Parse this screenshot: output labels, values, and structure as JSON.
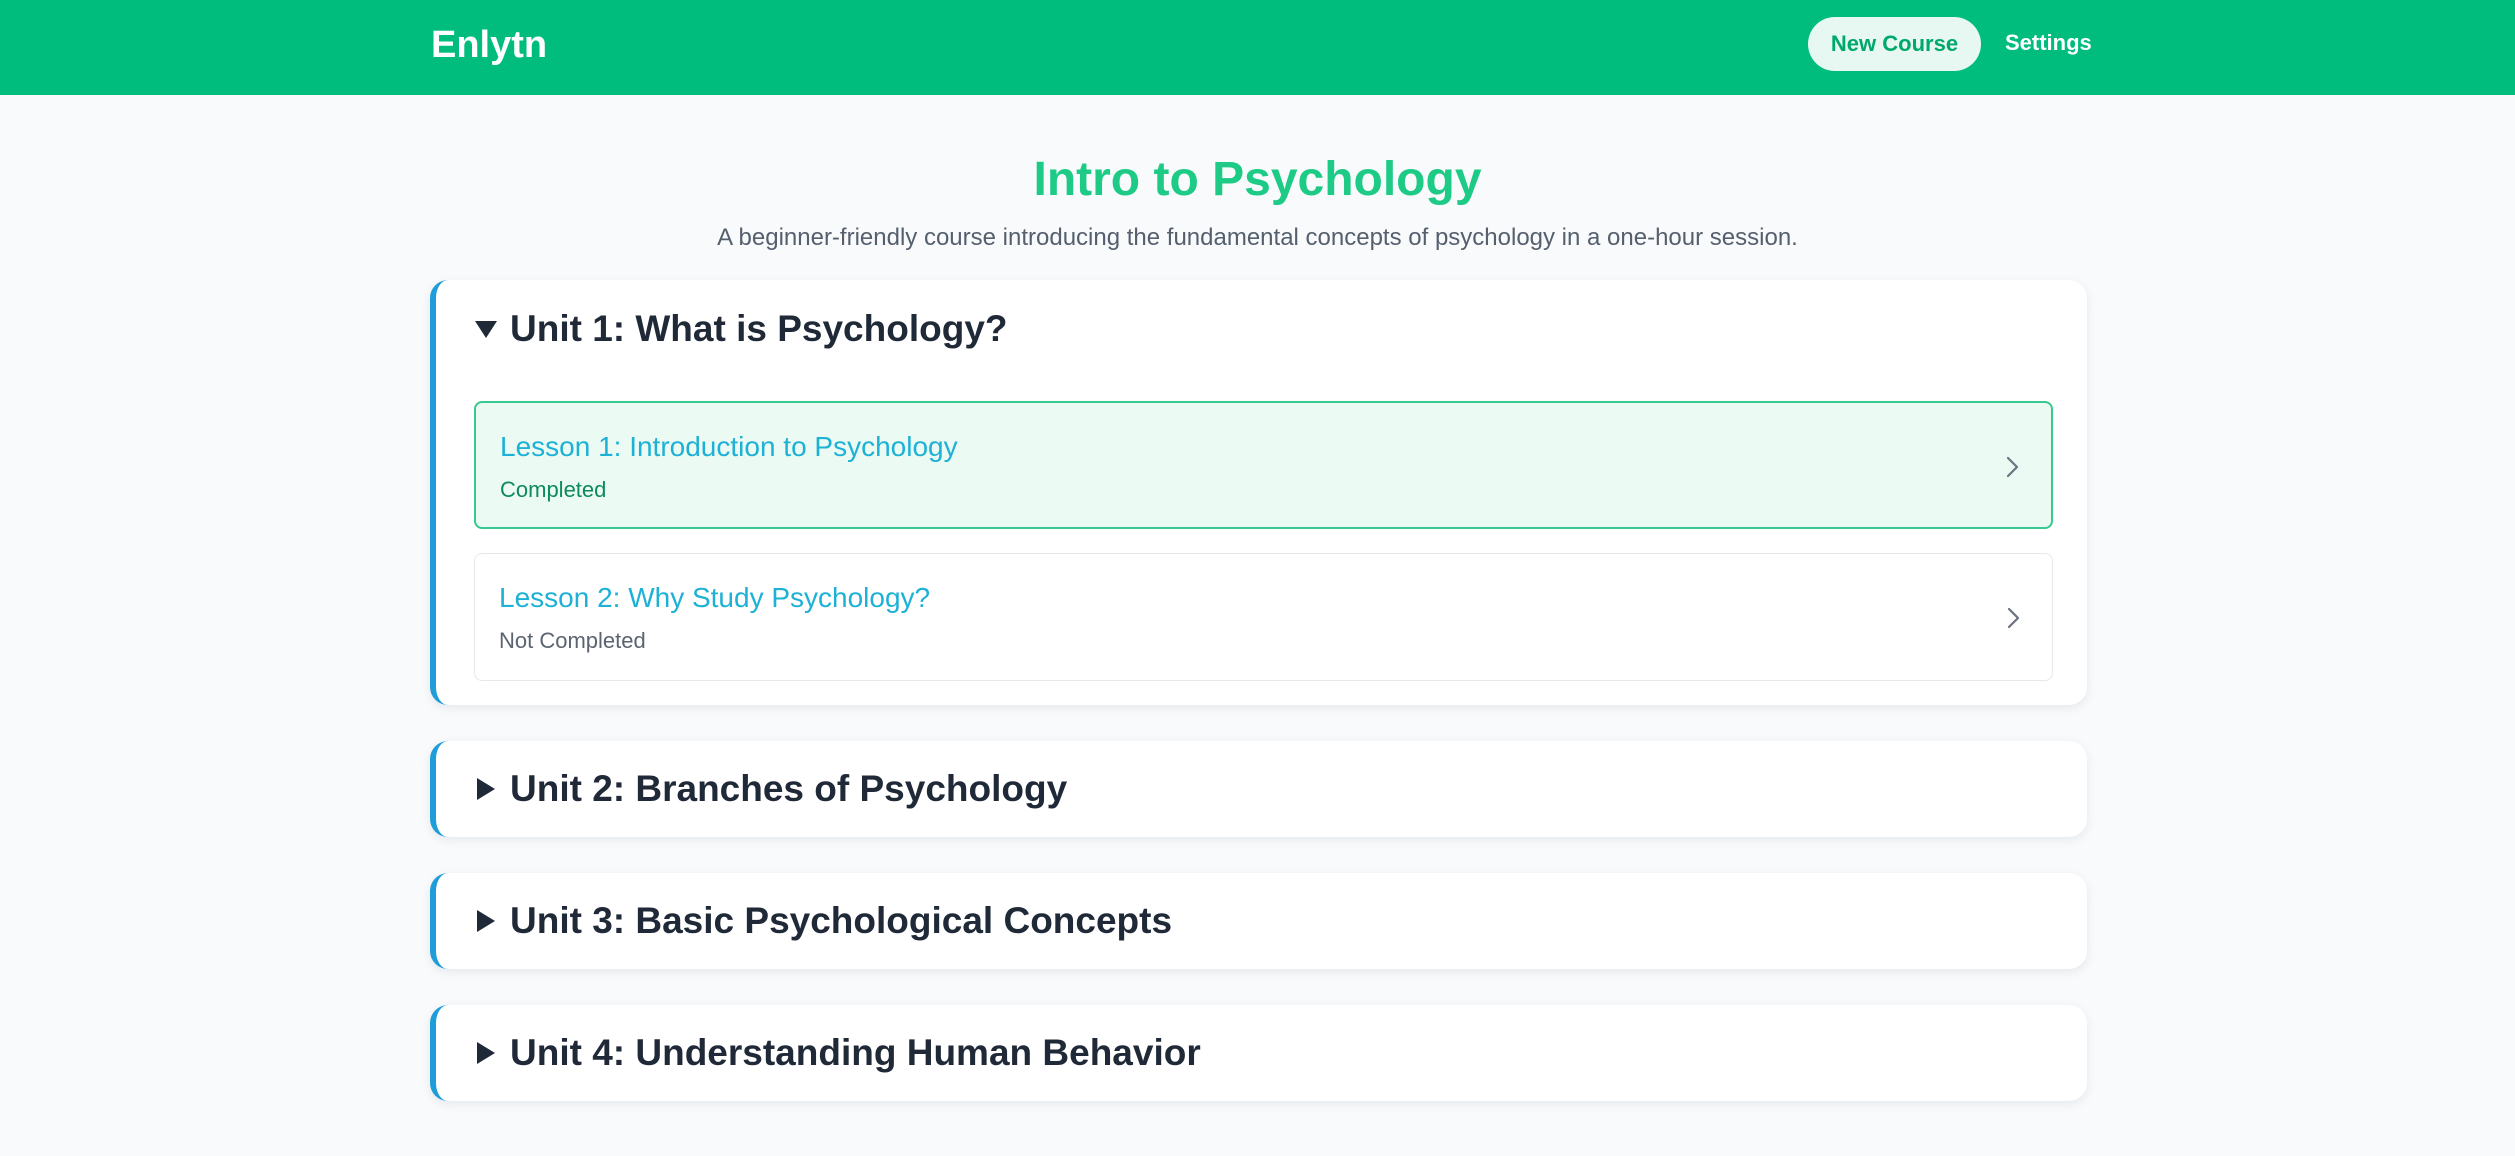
{
  "header": {
    "brand": "Enlytn",
    "new_course_label": "New Course",
    "settings_label": "Settings"
  },
  "course": {
    "title": "Intro to Psychology",
    "subtitle": "A beginner-friendly course introducing the fundamental concepts of psychology in a one-hour session."
  },
  "units": [
    {
      "title": "Unit 1: What is Psychology?",
      "expanded": true,
      "lessons": [
        {
          "title": "Lesson 1: Introduction to Psychology",
          "status": "Completed"
        },
        {
          "title": "Lesson 2: Why Study Psychology?",
          "status": "Not Completed"
        }
      ]
    },
    {
      "title": "Unit 2: Branches of Psychology",
      "expanded": false
    },
    {
      "title": "Unit 3: Basic Psychological Concepts",
      "expanded": false
    },
    {
      "title": "Unit 4: Understanding Human Behavior",
      "expanded": false
    }
  ],
  "icons": {
    "expanded_caret": "caret-down-icon",
    "collapsed_caret": "caret-right-icon",
    "lesson_arrow": "chevron-right-icon"
  },
  "colors": {
    "primary": "#00bd7e",
    "title": "#1ecb86",
    "unit_accent": "#1f9dd9",
    "lesson_link": "#1db1d6",
    "completed_bg": "#ebfbf3",
    "completed_border": "#38c991",
    "page_bg": "#f8fafc"
  }
}
